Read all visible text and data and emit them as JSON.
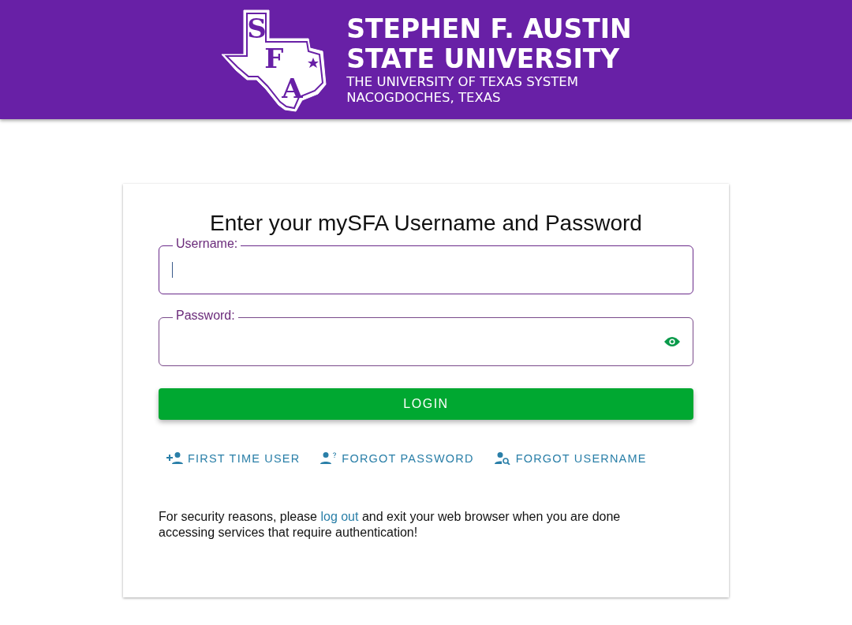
{
  "header": {
    "logo_letters": [
      "S",
      "F",
      "A"
    ],
    "title_lines": [
      "STEPHEN F. AUSTIN",
      "STATE UNIVERSITY"
    ],
    "subtitle_lines": [
      "THE UNIVERSITY OF TEXAS SYSTEM",
      "NACOGDOCHES, TEXAS"
    ]
  },
  "login": {
    "heading": "Enter your mySFA Username and Password",
    "fields": [
      {
        "kind": "text",
        "label": "Username:",
        "focused": true
      },
      {
        "kind": "password",
        "label": "Password:",
        "focused": false
      }
    ],
    "button": "LOGIN",
    "links": [
      {
        "kind": "add-user",
        "label": "FIRST TIME USER"
      },
      {
        "kind": "user-question",
        "label": "FORGOT PASSWORD"
      },
      {
        "kind": "user-search",
        "label": "FORGOT USERNAME"
      }
    ],
    "notice": "For security reasons, please ",
    "notice_link": "log out",
    "notice_end": " and exit your web browser when you are done accessing services that require authentication!"
  }
}
